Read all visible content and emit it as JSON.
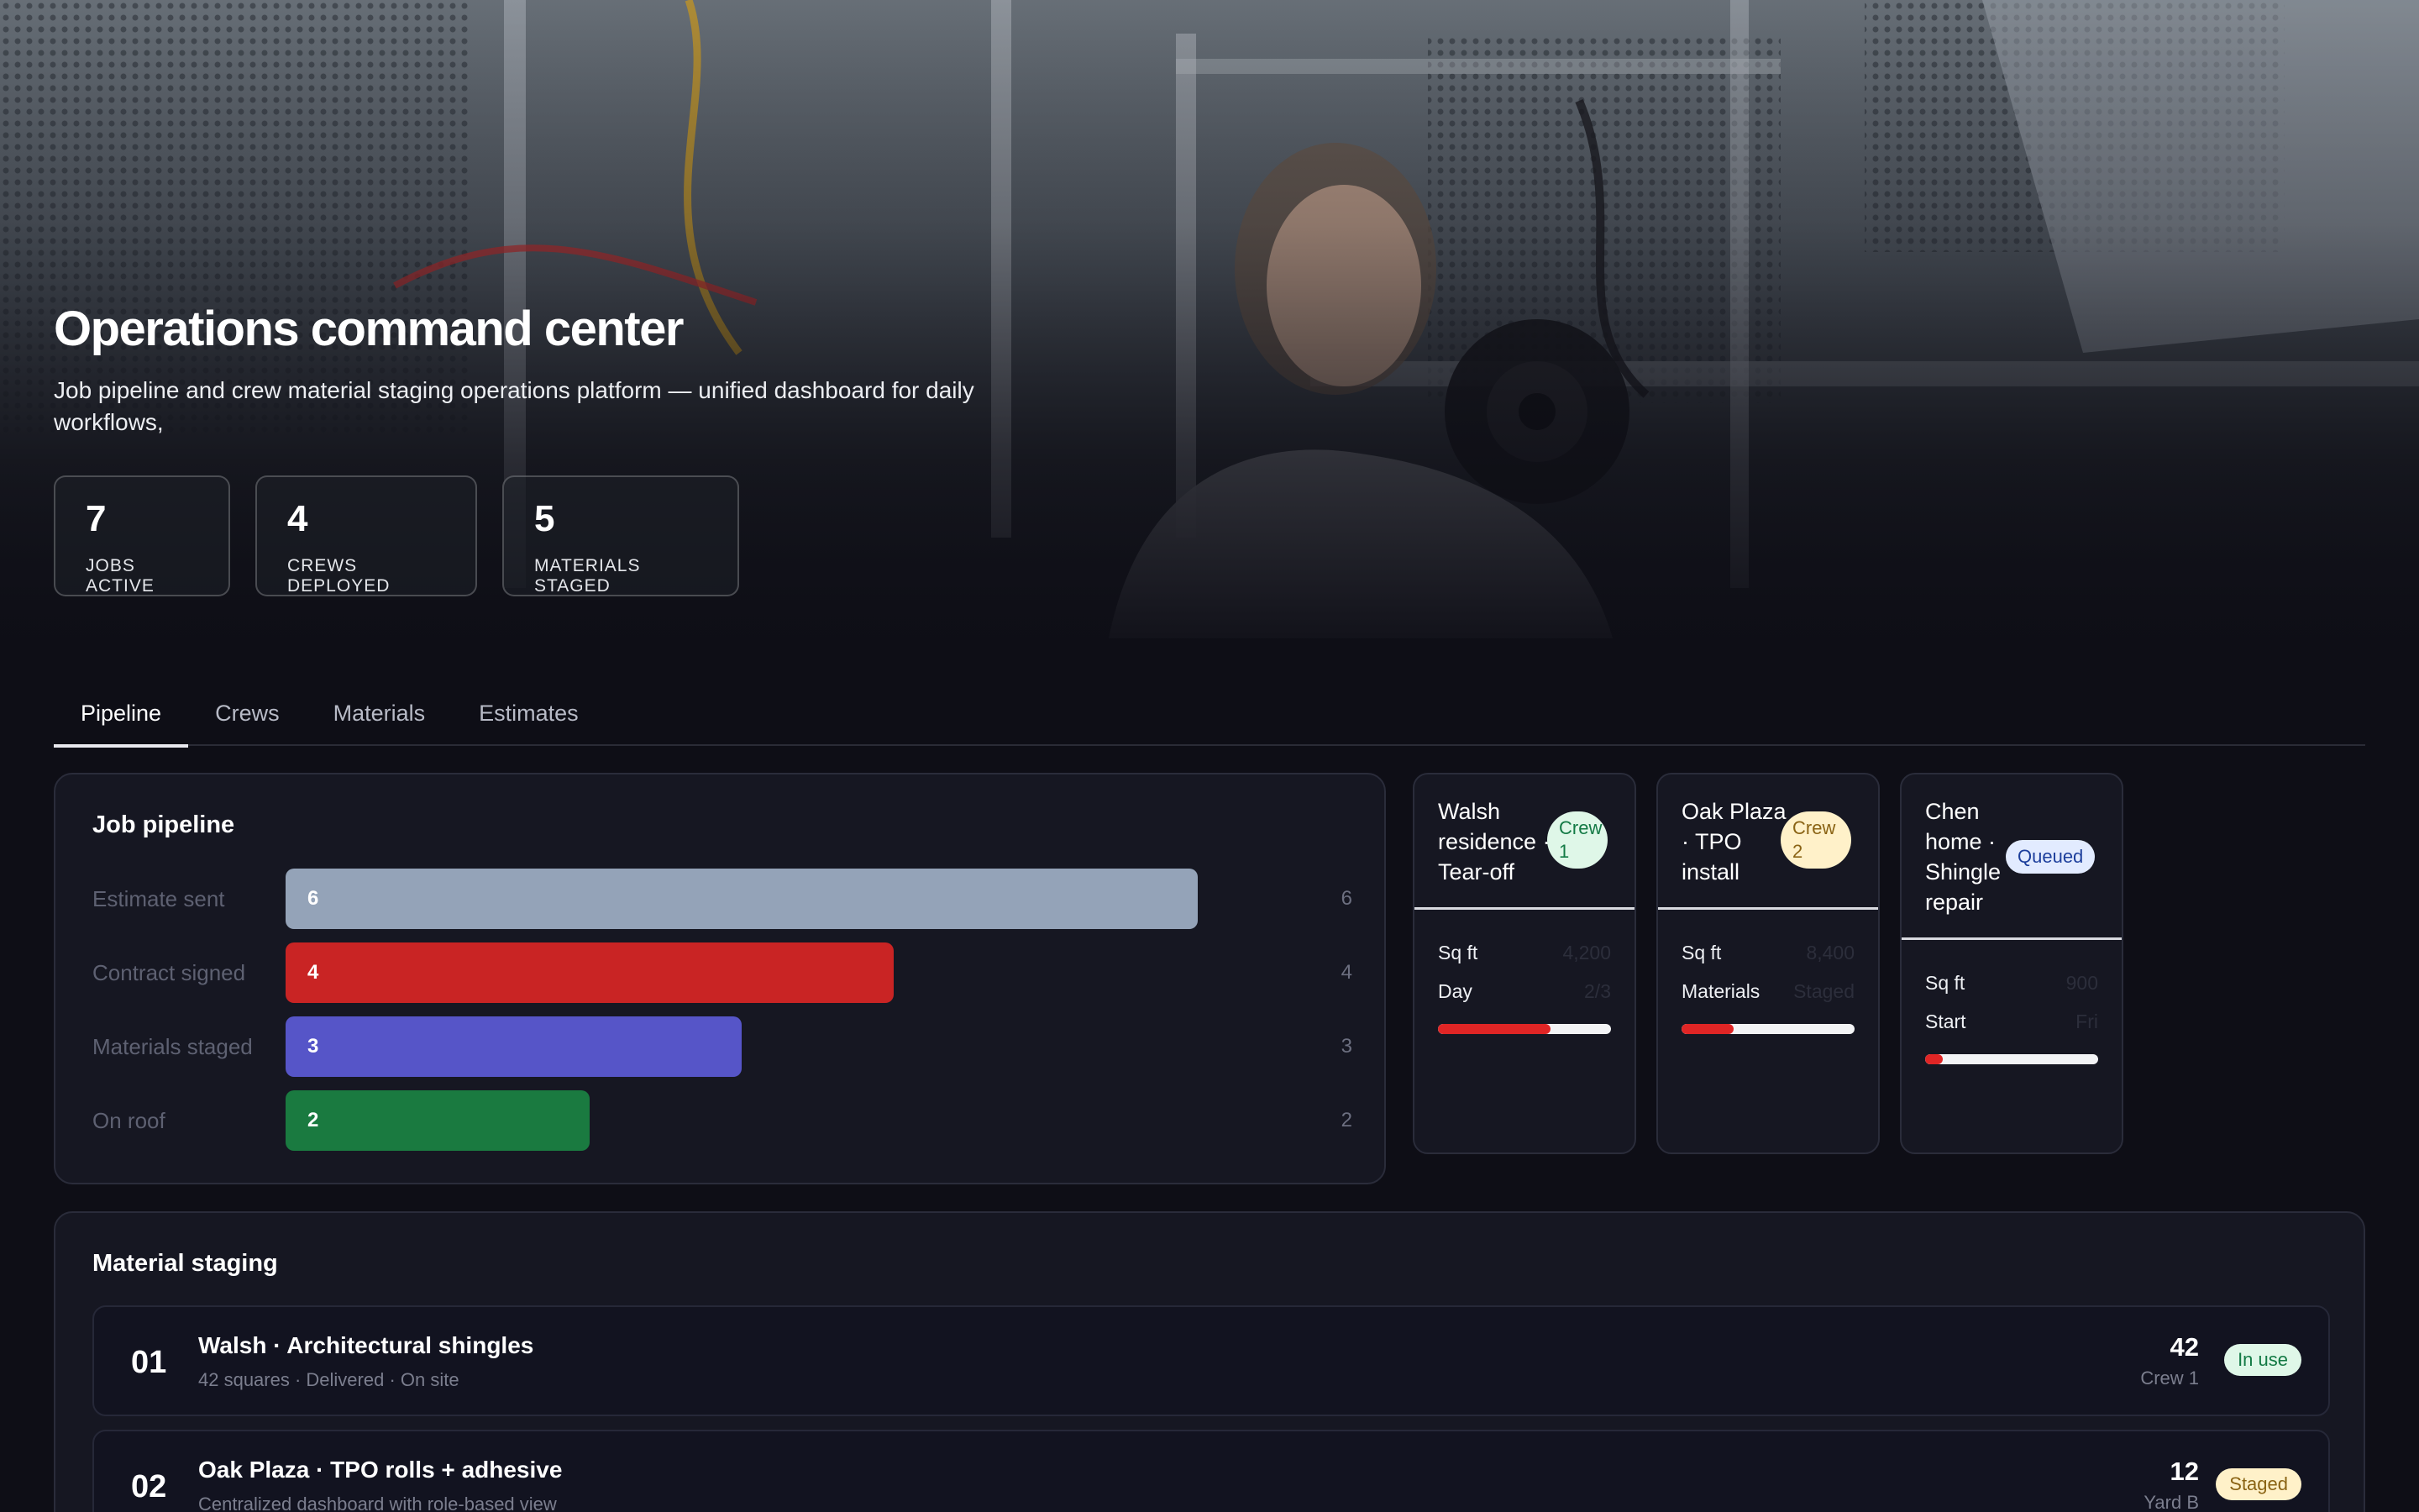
{
  "hero": {
    "title": "Operations command center",
    "subtitle": "Job pipeline and crew material staging operations platform — unified dashboard for daily workflows,",
    "stats": [
      {
        "value": "7",
        "label": "JOBS ACTIVE"
      },
      {
        "value": "4",
        "label": "CREWS DEPLOYED"
      },
      {
        "value": "5",
        "label": "MATERIALS STAGED"
      }
    ]
  },
  "tabs": [
    {
      "label": "Pipeline",
      "active": true
    },
    {
      "label": "Crews",
      "active": false
    },
    {
      "label": "Materials",
      "active": false
    },
    {
      "label": "Estimates",
      "active": false
    }
  ],
  "pipeline": {
    "title": "Job pipeline",
    "max": 6,
    "stages": [
      {
        "label": "Estimate sent",
        "value": 6,
        "bar_text": "6",
        "count": "6",
        "color": "#94a3b8"
      },
      {
        "label": "Contract signed",
        "value": 4,
        "bar_text": "4",
        "count": "4",
        "color": "#c92424"
      },
      {
        "label": "Materials staged",
        "value": 3,
        "bar_text": "3",
        "count": "3",
        "color": "#5655c8"
      },
      {
        "label": "On roof",
        "value": 2,
        "bar_text": "2",
        "count": "2",
        "color": "#1a7a40"
      }
    ]
  },
  "jobs": [
    {
      "name": "Walsh residence · Tear-off",
      "badge": "Crew 1",
      "badge_style": "green",
      "rows": [
        {
          "key": "Sq ft",
          "value": "4,200"
        },
        {
          "key": "Day",
          "value": "2/3"
        }
      ],
      "progress": 0.65
    },
    {
      "name": "Oak Plaza · TPO install",
      "badge": "Crew 2",
      "badge_style": "yellow",
      "rows": [
        {
          "key": "Sq ft",
          "value": "8,400"
        },
        {
          "key": "Materials",
          "value": "Staged"
        }
      ],
      "progress": 0.3
    },
    {
      "name": "Chen home · Shingle repair",
      "badge": "Queued",
      "badge_style": "blue",
      "rows": [
        {
          "key": "Sq ft",
          "value": "900"
        },
        {
          "key": "Start",
          "value": "Fri"
        }
      ],
      "progress": 0.1
    }
  ],
  "staging": {
    "title": "Material staging",
    "items": [
      {
        "num": "01",
        "title": "Walsh · Architectural shingles",
        "subtitle": "42 squares · Delivered · On site",
        "qty": "42",
        "location": "Crew 1",
        "status": "In use",
        "status_bg": "#dff7e8",
        "status_fg": "#137a45"
      },
      {
        "num": "02",
        "title": "Oak Plaza · TPO rolls + adhesive",
        "subtitle": "Centralized dashboard with role-based view",
        "qty": "12",
        "location": "Yard B",
        "status": "Staged",
        "status_bg": "#fff1c9",
        "status_fg": "#8a6314"
      }
    ]
  }
}
